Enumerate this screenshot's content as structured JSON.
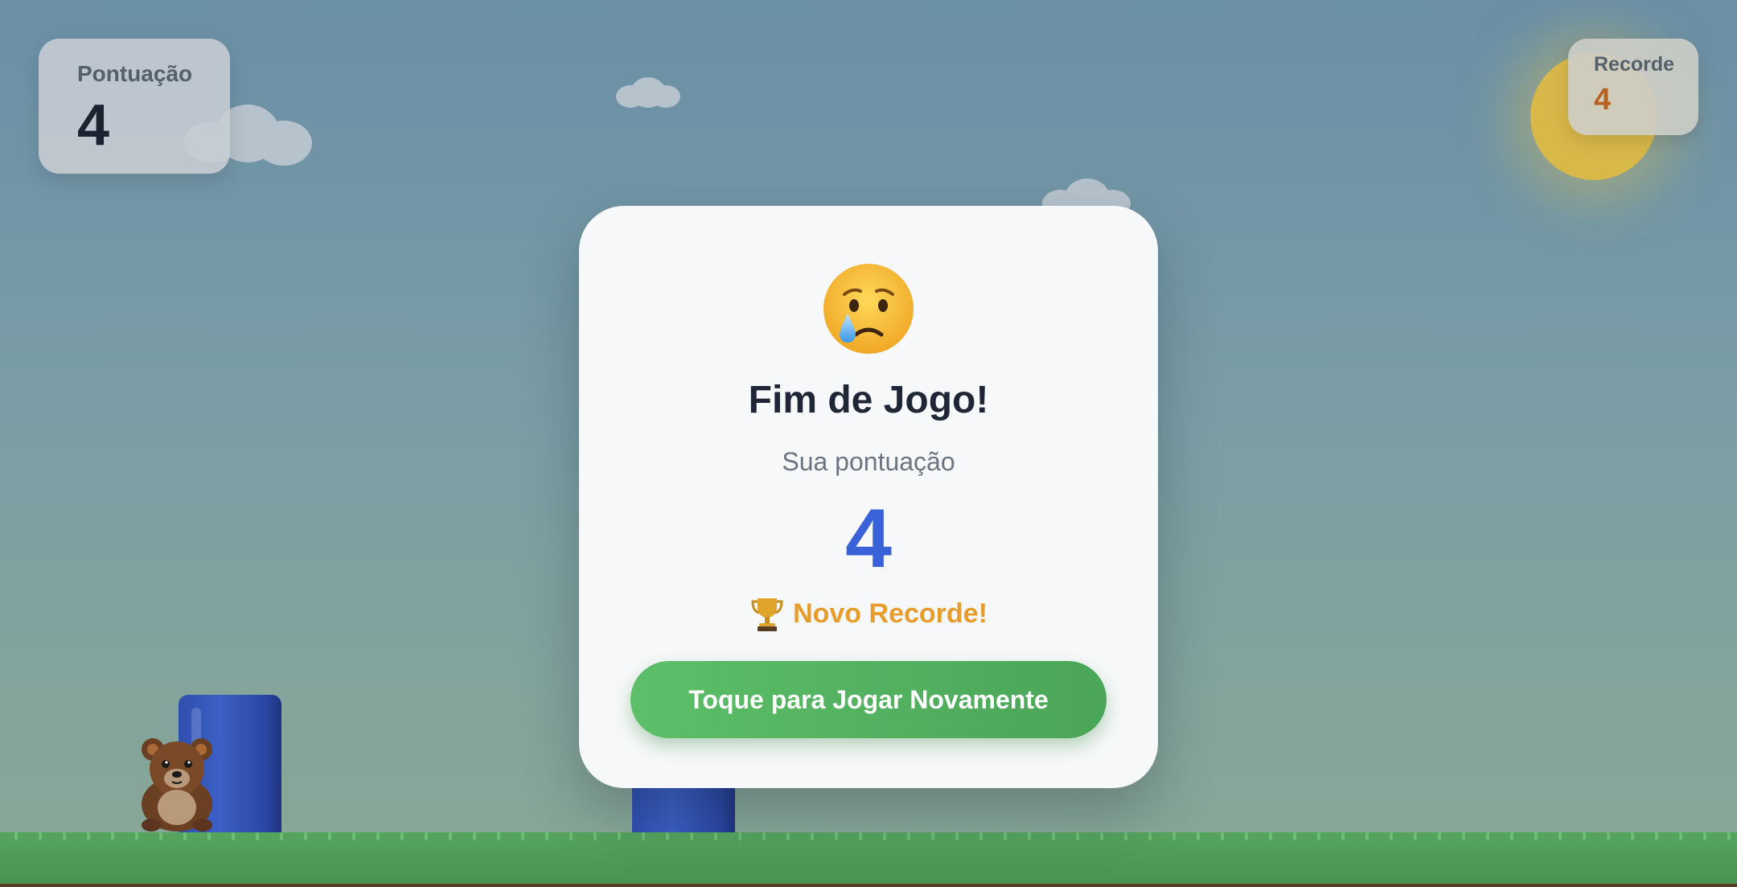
{
  "hud": {
    "score_label": "Pontuação",
    "score_value": "4",
    "record_label": "Recorde",
    "record_value": "4"
  },
  "game_over": {
    "emoji_icon": "crying-face-icon",
    "title": "Fim de Jogo!",
    "subtitle": "Sua pontuação",
    "score": "4",
    "new_record_icon": "trophy-icon",
    "new_record_text": "Novo Recorde!",
    "replay_button": "Toque para Jogar Novamente"
  },
  "colors": {
    "score_accent": "#3a62d8",
    "record_accent": "#e89c2c",
    "button_green": "#55b562",
    "pipe_blue": "#2f4fb0"
  }
}
